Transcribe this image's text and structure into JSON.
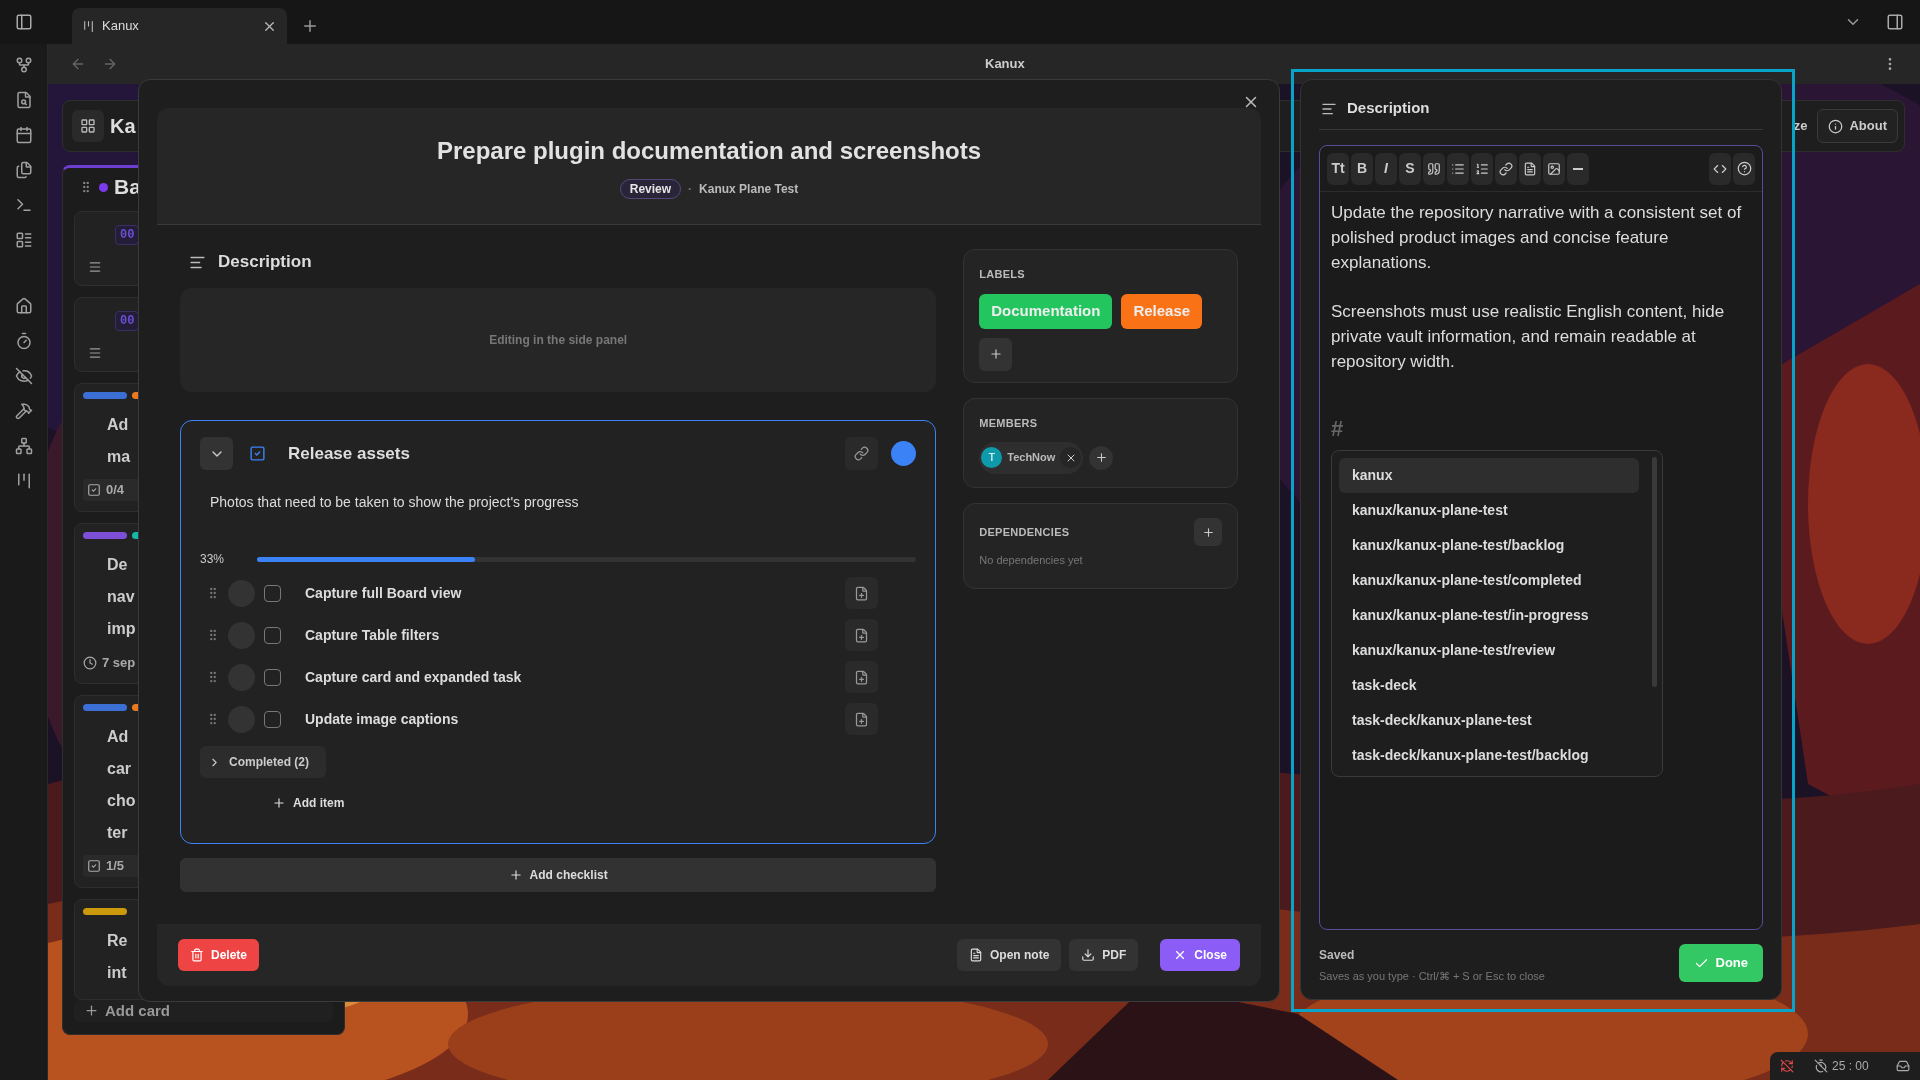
{
  "tab_bar": {
    "tab": "Kanux"
  },
  "nav": {
    "title": "Kanux"
  },
  "board": {
    "title": "Ka",
    "buttons": [
      "ze",
      "About"
    ],
    "column": {
      "title": "Ba",
      "color": "#7c3aed",
      "add_card": "Add card",
      "cards": [
        {
          "kind": "id",
          "badge": "00"
        },
        {
          "kind": "id",
          "badge": "00"
        },
        {
          "kind": "task",
          "tags": [
            {
              "color": "#3b6fd4"
            },
            {
              "color": "#ea7a1f"
            }
          ],
          "title_lines": [
            "Ad",
            "ma"
          ],
          "meta": {
            "kind": "checklist",
            "text": "0/4"
          }
        },
        {
          "kind": "task",
          "tags": [
            {
              "color": "#7c4fd6"
            },
            {
              "color": "#14b8a6"
            }
          ],
          "title_lines": [
            "De",
            "nav",
            "imp"
          ],
          "meta": {
            "kind": "date",
            "text": "7 sep"
          }
        },
        {
          "kind": "task",
          "tags": [
            {
              "color": "#3b6fd4"
            },
            {
              "color": "#ea7a1f"
            }
          ],
          "title_lines": [
            "Ad",
            "car",
            "cho",
            "ter"
          ],
          "meta": {
            "kind": "checklist",
            "text": "1/5"
          }
        },
        {
          "kind": "task",
          "tags": [
            {
              "color": "#ca9a0c"
            }
          ],
          "title_lines": [
            "Re",
            "int"
          ]
        }
      ]
    }
  },
  "modal": {
    "title": "Prepare plugin documentation and screenshots",
    "status": "Review",
    "separator": "·",
    "board": "Kanux Plane Test",
    "description": {
      "heading": "Description",
      "placeholder": "Editing in the side panel"
    },
    "checklist": {
      "title": "Release assets",
      "expanded": true,
      "color": "#3b82f6",
      "description": "Photos that need to be taken to show the project's progress",
      "progress": "33%",
      "level": 0.33,
      "items": [
        {
          "text": "Capture full Board view",
          "checked": false
        },
        {
          "text": "Capture Table filters",
          "checked": false
        },
        {
          "text": "Capture card and expanded task",
          "checked": false
        },
        {
          "text": "Update image captions",
          "checked": false
        }
      ],
      "completed": "Completed (2)",
      "add_item": "Add item"
    },
    "add_checklist": "Add checklist",
    "labels": {
      "heading": "LABELS",
      "items": [
        {
          "name": "Documentation",
          "color": "#22c55e"
        },
        {
          "name": "Release",
          "color": "#f97316"
        }
      ]
    },
    "members": {
      "heading": "MEMBERS",
      "items": [
        {
          "initial": "T",
          "name": "TechNow",
          "color": "#0e9aab"
        }
      ]
    },
    "dependencies": {
      "heading": "DEPENDENCIES",
      "empty": "No dependencies yet"
    },
    "footer": {
      "delete": "Delete",
      "open_note": "Open note",
      "pdf": "PDF",
      "close": "Close"
    }
  },
  "side_panel": {
    "heading": "Description",
    "format_buttons": [
      "Tt",
      "B",
      "I",
      "S"
    ],
    "paragraphs": [
      "Update the repository narrative with a consistent set of polished product images and concise feature explanations.",
      "Screenshots must use realistic English content, hide private vault information, and remain readable at repository width."
    ],
    "hash": "#",
    "suggestions": [
      {
        "text": "kanux",
        "selected": true
      },
      {
        "text": "kanux/kanux-plane-test",
        "selected": false
      },
      {
        "text": "kanux/kanux-plane-test/backlog",
        "selected": false
      },
      {
        "text": "kanux/kanux-plane-test/completed",
        "selected": false
      },
      {
        "text": "kanux/kanux-plane-test/in-progress",
        "selected": false
      },
      {
        "text": "kanux/kanux-plane-test/review",
        "selected": false
      },
      {
        "text": "task-deck",
        "selected": false
      },
      {
        "text": "task-deck/kanux-plane-test",
        "selected": false
      },
      {
        "text": "task-deck/kanux-plane-test/backlog",
        "selected": false
      }
    ],
    "status": "Saved",
    "hint": "Saves as you type · Ctrl/⌘ + S or Esc to close",
    "done": "Done"
  },
  "status_bar": {
    "timer": "25 : 00"
  }
}
